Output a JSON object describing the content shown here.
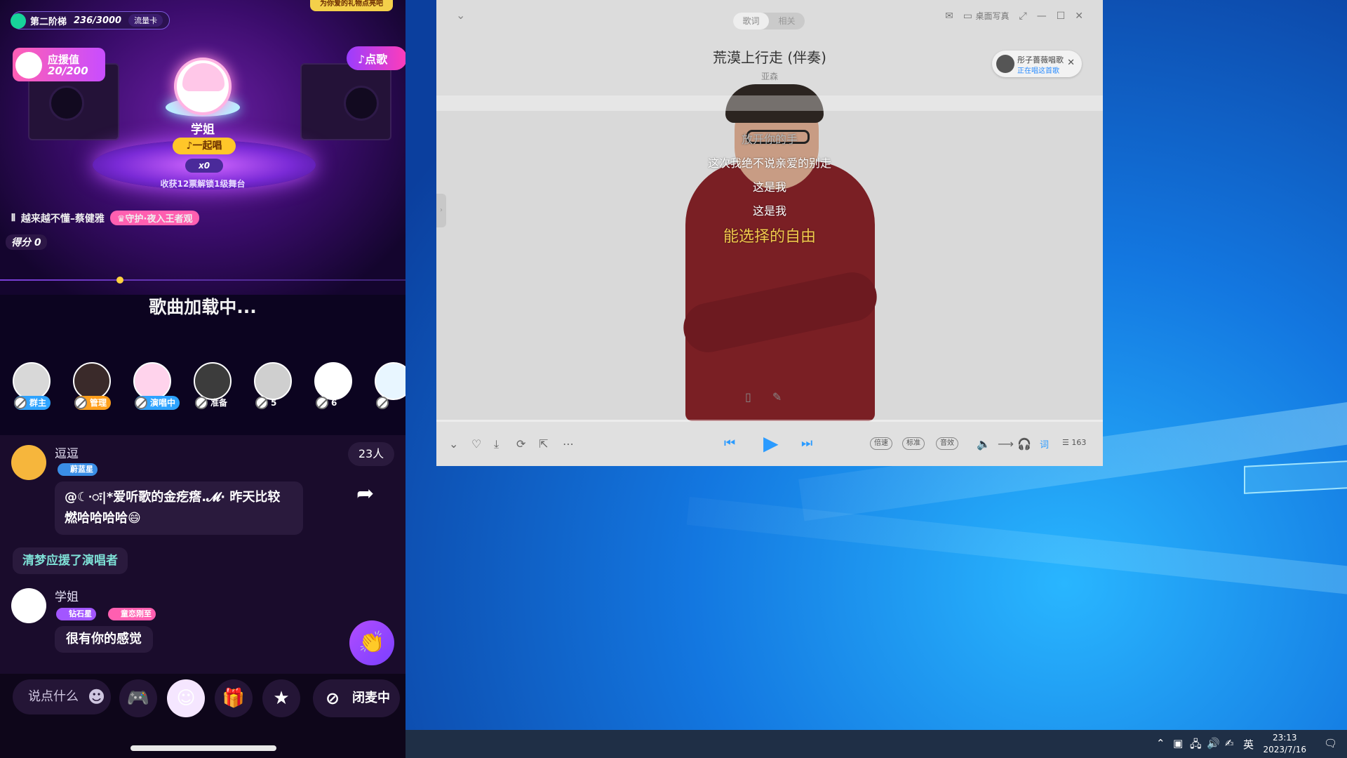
{
  "phone": {
    "stage_label": "第二阶梯",
    "stage_progress": "236/3000",
    "stage_tag": "流量卡",
    "top_banner": "为你爱的礼物点亮吧",
    "cheer_label": "应援值",
    "cheer_value": "20/200",
    "song_button": "♪点歌",
    "singer_name": "学姐",
    "sing_together": "♪一起唱",
    "ticket_count": "x0",
    "stage_hint": "收获12票解锁1级舞台",
    "now_song": "越来越不懂–蔡健雅",
    "guard_tag": "♛守护·夜入王者观",
    "score": "得分 0",
    "loading": "歌曲加载中...",
    "mic_slots": [
      {
        "role": "群主",
        "color": "#2ea3ff"
      },
      {
        "role": "管理",
        "color": "#ff9f1c"
      },
      {
        "role": "演唱中",
        "color": "#2ea3ff"
      },
      {
        "role": "准备",
        "color": ""
      },
      {
        "role": "5",
        "color": ""
      },
      {
        "role": "6",
        "color": ""
      },
      {
        "role": "",
        "color": ""
      }
    ],
    "online_count": "23人",
    "chat": {
      "msg1_name": "逗逗",
      "msg1_badge": "蔚蓝星",
      "msg1_text_line1": "@☾·ः|*爱听歌的金疙瘩.𝓜· 昨天比较",
      "msg1_text_line2": "燃哈哈哈哈😄",
      "system_msg": "清梦应援了演唱者",
      "msg2_name": "学姐",
      "msg2_badge1": "钻石星",
      "msg2_badge2": "童恋刚至",
      "msg2_text": "很有你的感觉"
    },
    "input_placeholder": "说点什么",
    "mic_off_label": "闭麦中"
  },
  "player": {
    "tabs": [
      "歌词",
      "相关"
    ],
    "desktop_lyric": "桌面写真",
    "song_title": "荒漠上行走 (伴奏)",
    "artist": "亚森",
    "now_singing_name": "彤子薔薇唱歌",
    "now_singing_status": "正在唱这首歌",
    "lyrics": [
      {
        "text": "放开你的手",
        "style": "dim"
      },
      {
        "text": "这次我绝不说亲爱的别走",
        "style": ""
      },
      {
        "text": "这是我",
        "style": ""
      },
      {
        "text": "这是我",
        "style": ""
      },
      {
        "text": "能选择的自由",
        "style": "current"
      }
    ],
    "progress": 0.0,
    "speed_label": "倍速",
    "quality_label": "标准",
    "effect_label": "音效",
    "lyric_toggle": "词",
    "playlist_count": "163"
  },
  "taskbar": {
    "ime": "英",
    "time": "23:13",
    "date": "2023/7/16"
  }
}
